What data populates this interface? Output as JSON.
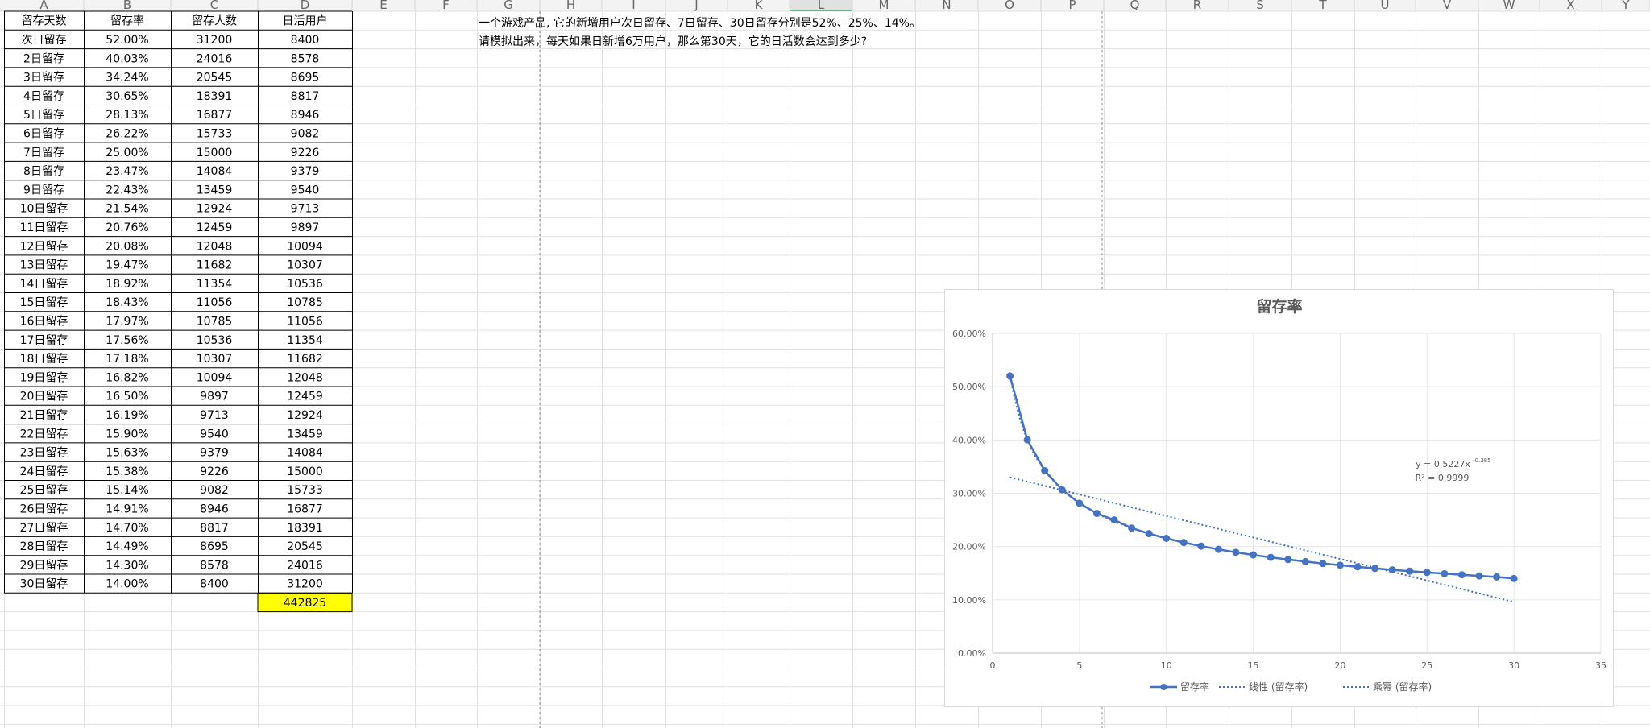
{
  "columns": [
    "A",
    "B",
    "C",
    "D",
    "E",
    "F",
    "G",
    "H",
    "I",
    "J",
    "K",
    "L",
    "M",
    "N",
    "O",
    "P",
    "Q",
    "R",
    "S",
    "T",
    "U",
    "V",
    "W",
    "X",
    "Y"
  ],
  "selected_column": "L",
  "table": {
    "headers": [
      "留存天数",
      "留存率",
      "留存人数",
      "日活用户"
    ],
    "rows": [
      [
        "次日留存",
        "52.00%",
        "31200",
        "8400"
      ],
      [
        "2日留存",
        "40.03%",
        "24016",
        "8578"
      ],
      [
        "3日留存",
        "34.24%",
        "20545",
        "8695"
      ],
      [
        "4日留存",
        "30.65%",
        "18391",
        "8817"
      ],
      [
        "5日留存",
        "28.13%",
        "16877",
        "8946"
      ],
      [
        "6日留存",
        "26.22%",
        "15733",
        "9082"
      ],
      [
        "7日留存",
        "25.00%",
        "15000",
        "9226"
      ],
      [
        "8日留存",
        "23.47%",
        "14084",
        "9379"
      ],
      [
        "9日留存",
        "22.43%",
        "13459",
        "9540"
      ],
      [
        "10日留存",
        "21.54%",
        "12924",
        "9713"
      ],
      [
        "11日留存",
        "20.76%",
        "12459",
        "9897"
      ],
      [
        "12日留存",
        "20.08%",
        "12048",
        "10094"
      ],
      [
        "13日留存",
        "19.47%",
        "11682",
        "10307"
      ],
      [
        "14日留存",
        "18.92%",
        "11354",
        "10536"
      ],
      [
        "15日留存",
        "18.43%",
        "11056",
        "10785"
      ],
      [
        "16日留存",
        "17.97%",
        "10785",
        "11056"
      ],
      [
        "17日留存",
        "17.56%",
        "10536",
        "11354"
      ],
      [
        "18日留存",
        "17.18%",
        "10307",
        "11682"
      ],
      [
        "19日留存",
        "16.82%",
        "10094",
        "12048"
      ],
      [
        "20日留存",
        "16.50%",
        "9897",
        "12459"
      ],
      [
        "21日留存",
        "16.19%",
        "9713",
        "12924"
      ],
      [
        "22日留存",
        "15.90%",
        "9540",
        "13459"
      ],
      [
        "23日留存",
        "15.63%",
        "9379",
        "14084"
      ],
      [
        "24日留存",
        "15.38%",
        "9226",
        "15000"
      ],
      [
        "25日留存",
        "15.14%",
        "9082",
        "15733"
      ],
      [
        "26日留存",
        "14.91%",
        "8946",
        "16877"
      ],
      [
        "27日留存",
        "14.70%",
        "8817",
        "18391"
      ],
      [
        "28日留存",
        "14.49%",
        "8695",
        "20545"
      ],
      [
        "29日留存",
        "14.30%",
        "8578",
        "24016"
      ],
      [
        "30日留存",
        "14.00%",
        "8400",
        "31200"
      ]
    ],
    "total": "442825",
    "total_highlight": "#ffff00"
  },
  "notes": [
    "一个游戏产品, 它的新增用户次日留存、7日留存、30日留存分别是52%、25%、14%。",
    "请模拟出来，每天如果日新增6万用户，那么第30天，它的日活数会达到多少?"
  ],
  "chart_data": {
    "type": "scatter",
    "title": "留存率",
    "x": [
      1,
      2,
      3,
      4,
      5,
      6,
      7,
      8,
      9,
      10,
      11,
      12,
      13,
      14,
      15,
      16,
      17,
      18,
      19,
      20,
      21,
      22,
      23,
      24,
      25,
      26,
      27,
      28,
      29,
      30
    ],
    "series": [
      {
        "name": "留存率",
        "values": [
          52.0,
          40.03,
          34.24,
          30.65,
          28.13,
          26.22,
          25.0,
          23.47,
          22.43,
          21.54,
          20.76,
          20.08,
          19.47,
          18.92,
          18.43,
          17.97,
          17.56,
          17.18,
          16.82,
          16.5,
          16.19,
          15.9,
          15.63,
          15.38,
          15.14,
          14.91,
          14.7,
          14.49,
          14.3,
          14.0
        ],
        "color": "#4472c4"
      }
    ],
    "trendlines": [
      {
        "name": "线性 (留存率)",
        "kind": "linear",
        "from": [
          1,
          33.0
        ],
        "to": [
          30,
          9.6
        ]
      },
      {
        "name": "乘幂 (留存率)",
        "kind": "power",
        "a": 0.5227,
        "b": -0.385
      }
    ],
    "equation": "y = 0.5227x",
    "equation_exponent": "-0.385",
    "r_squared": "R² = 0.9999",
    "xlim": [
      0,
      35
    ],
    "ylim": [
      0,
      60
    ],
    "x_ticks": [
      "0",
      "5",
      "10",
      "15",
      "20",
      "25",
      "30",
      "35"
    ],
    "y_ticks": [
      "0.00%",
      "10.00%",
      "20.00%",
      "30.00%",
      "40.00%",
      "50.00%",
      "60.00%"
    ],
    "grid": true,
    "legend_position": "bottom",
    "legend": [
      "留存率",
      "线性 (留存率)",
      "乘幂 (留存率)"
    ]
  }
}
